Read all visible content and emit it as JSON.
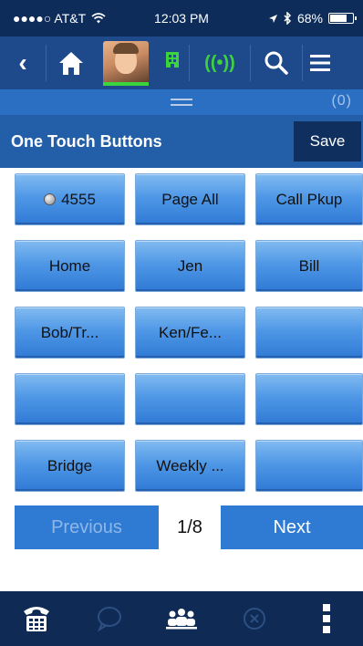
{
  "status_bar": {
    "carrier": "●●●●○ AT&T",
    "time": "12:03 PM",
    "battery": "68%",
    "battery_level": 0.68
  },
  "top_nav": {
    "icons": [
      "back-icon",
      "home-icon",
      "avatar",
      "building-icon",
      "signal-icon",
      "search-icon",
      "menu-icon"
    ],
    "signal_glyph": "((•))",
    "back_glyph": "‹"
  },
  "sub_bar": {
    "count": "(0)"
  },
  "title_bar": {
    "title": "One Touch Buttons",
    "save_label": "Save"
  },
  "buttons": [
    {
      "label": "4555",
      "has_led": true
    },
    {
      "label": "Page All"
    },
    {
      "label": "Call Pkup"
    },
    {
      "label": "Home"
    },
    {
      "label": "Jen"
    },
    {
      "label": "Bill"
    },
    {
      "label": "Bob/Tr..."
    },
    {
      "label": "Ken/Fe..."
    },
    {
      "label": ""
    },
    {
      "label": ""
    },
    {
      "label": ""
    },
    {
      "label": ""
    },
    {
      "label": "Bridge"
    },
    {
      "label": "Weekly ..."
    },
    {
      "label": ""
    }
  ],
  "pager": {
    "previous_label": "Previous",
    "page": "1/8",
    "next_label": "Next"
  },
  "bottom_bar": {
    "icons": [
      "dialpad-icon",
      "chat-icon",
      "contacts-icon",
      "close-circle-icon",
      "more-icon"
    ]
  },
  "colors": {
    "status_bg": "#0d2c5a",
    "nav_bg": "#1e4a8c",
    "title_bg": "#235fa9",
    "save_bg": "#0f305f",
    "button_blue": "#4f98e6",
    "presence_green": "#3cd43c",
    "bottom_bg": "#0e2a55"
  }
}
